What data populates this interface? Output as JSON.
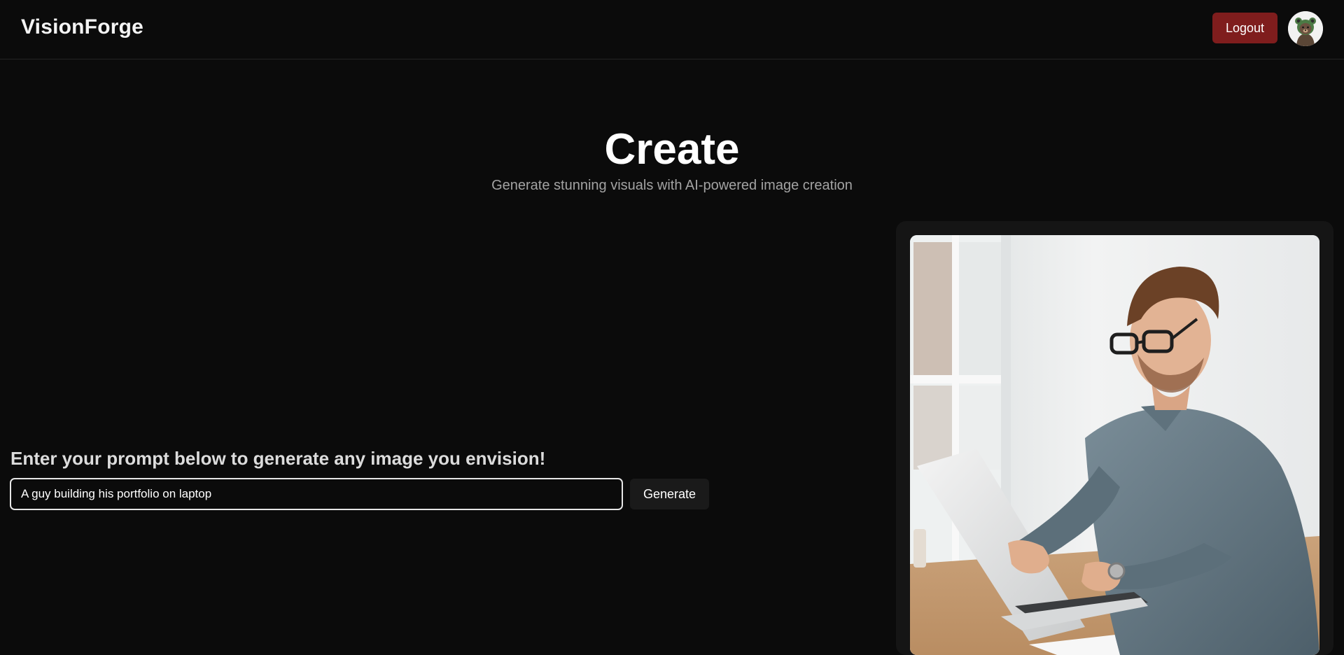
{
  "header": {
    "brand": "VisionForge",
    "logout_label": "Logout",
    "avatar_icon": "bear-avatar-icon"
  },
  "hero": {
    "title": "Create",
    "subtitle": "Generate stunning visuals with AI-powered image creation"
  },
  "prompt": {
    "heading": "Enter your prompt below to generate any image you envision!",
    "value": "A guy building his portfolio on laptop",
    "generate_label": "Generate"
  },
  "result": {
    "image_icon": "generated-image"
  },
  "colors": {
    "background": "#0b0b0b",
    "logout": "#7f1d1d",
    "card": "#151515",
    "subtitle": "#a3a3a3"
  }
}
